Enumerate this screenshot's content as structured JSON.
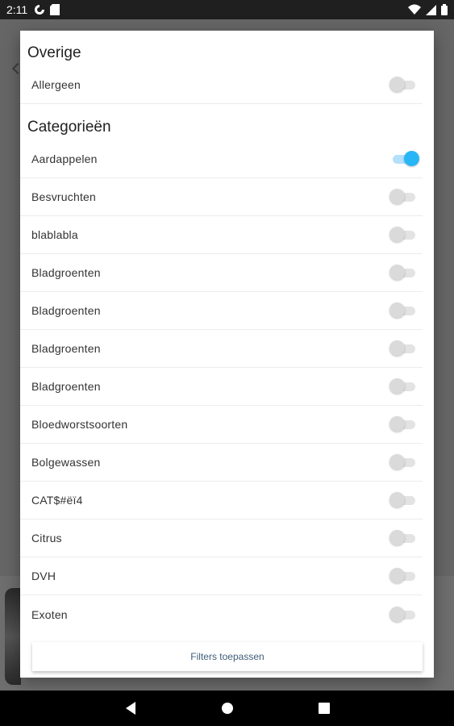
{
  "status_bar": {
    "time": "2:11",
    "left_icons": [
      "data-saver-icon",
      "sd-card-icon"
    ],
    "right_icons": [
      "wifi-icon",
      "signal-icon",
      "battery-icon"
    ]
  },
  "dialog": {
    "sections": [
      {
        "title": "Overige",
        "items": [
          {
            "label": "Allergeen",
            "on": false
          }
        ]
      },
      {
        "title": "Categorieën",
        "items": [
          {
            "label": "Aardappelen",
            "on": true
          },
          {
            "label": "Besvruchten",
            "on": false
          },
          {
            "label": "blablabla",
            "on": false
          },
          {
            "label": "Bladgroenten",
            "on": false
          },
          {
            "label": "Bladgroenten",
            "on": false
          },
          {
            "label": "Bladgroenten",
            "on": false
          },
          {
            "label": "Bladgroenten",
            "on": false
          },
          {
            "label": "Bloedworstsoorten",
            "on": false
          },
          {
            "label": "Bolgewassen",
            "on": false
          },
          {
            "label": "CAT$#ëï4",
            "on": false
          },
          {
            "label": "Citrus",
            "on": false
          },
          {
            "label": "DVH",
            "on": false
          },
          {
            "label": "Exoten",
            "on": false
          }
        ]
      }
    ],
    "apply_button": "Filters toepassen"
  },
  "colors": {
    "accent": "#29b6f6",
    "accent_track": "#b3e0fb",
    "scrim": "#6b6b6b"
  },
  "nav_bar": {
    "icons": [
      "back-icon",
      "home-icon",
      "recents-icon"
    ]
  }
}
